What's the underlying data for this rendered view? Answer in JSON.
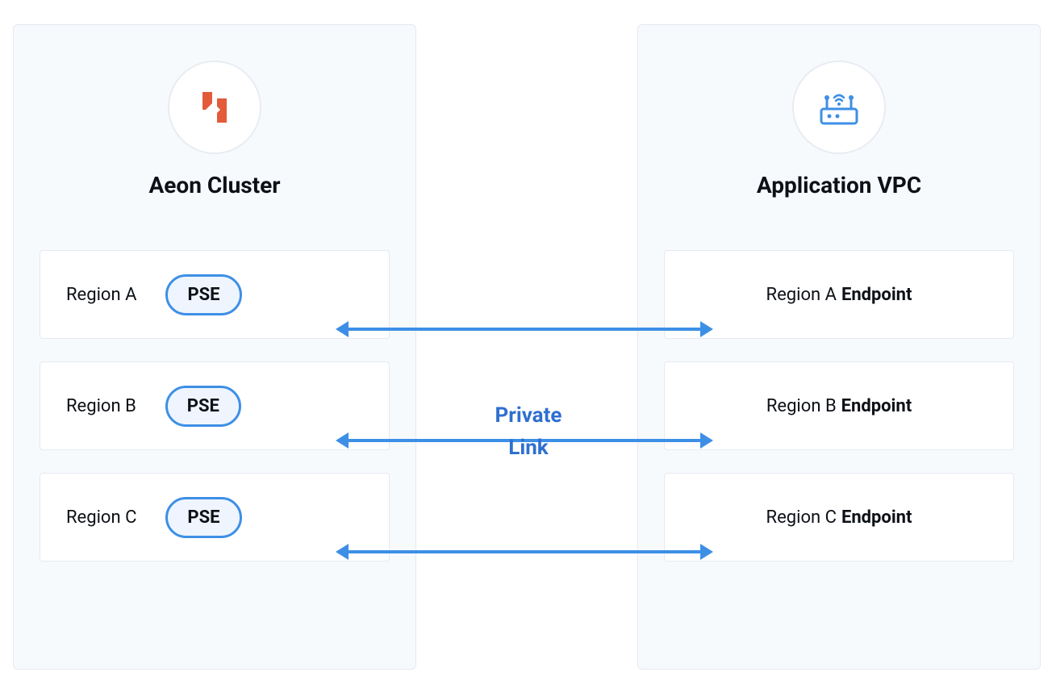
{
  "left_panel": {
    "title": "Aeon Cluster",
    "regions": [
      {
        "label": "Region A",
        "badge": "PSE"
      },
      {
        "label": "Region B",
        "badge": "PSE"
      },
      {
        "label": "Region C",
        "badge": "PSE"
      }
    ]
  },
  "right_panel": {
    "title": "Application VPC",
    "endpoints": [
      {
        "prefix": "Region A",
        "suffix": "Endpoint"
      },
      {
        "prefix": "Region B",
        "suffix": "Endpoint"
      },
      {
        "prefix": "Region C",
        "suffix": "Endpoint"
      }
    ]
  },
  "link_label": {
    "line1": "Private",
    "line2": "Link"
  },
  "colors": {
    "accent_blue": "#3d8fe6",
    "panel_bg": "#f7fafd",
    "panel_border": "#e5e9f0"
  }
}
